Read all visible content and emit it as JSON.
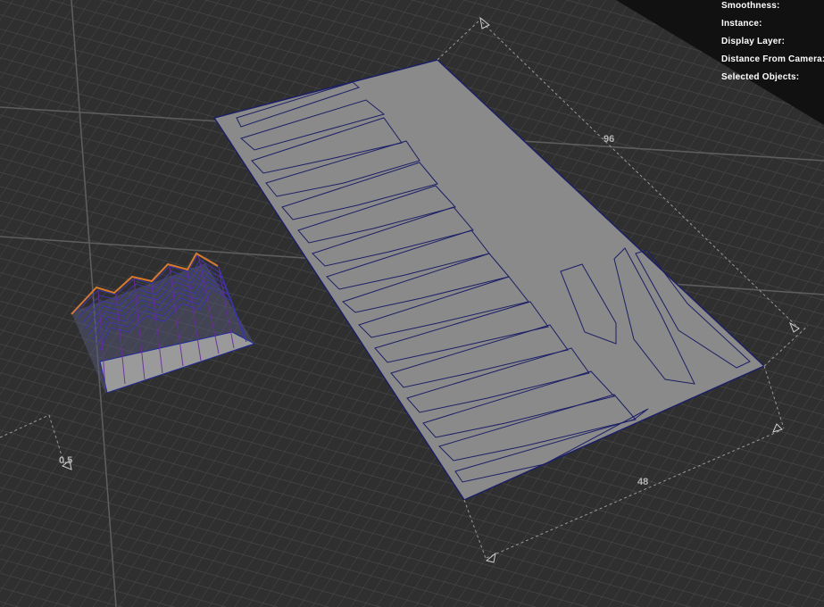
{
  "hud": {
    "smoothness_label": "Smoothness:",
    "instance_label": "Instance:",
    "display_layer_label": "Display Layer:",
    "distance_from_camera_label": "Distance From Camera:",
    "selected_objects_label": "Selected Objects:"
  },
  "dimensions": {
    "length_label": "96",
    "width_label": "48",
    "small_label": "0.5"
  },
  "colors": {
    "grid_line": "#4a4a4a",
    "sheet_fill": "#8a8a8a",
    "outline": "#1c1f66",
    "selection_orange": "#d97a2a",
    "selection_purple": "#5a2a8a",
    "selection_blue": "#2a36b8",
    "dim_line": "#9a9a9a"
  }
}
